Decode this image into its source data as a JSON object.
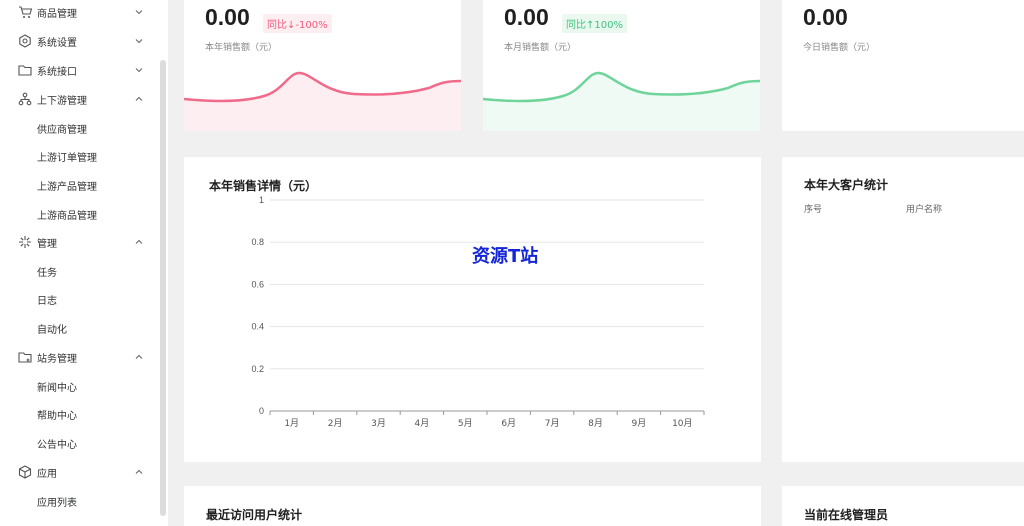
{
  "sidebar": {
    "groups": [
      {
        "label": "商品管理",
        "icon": "cart-icon",
        "expanded": false
      },
      {
        "label": "系统设置",
        "icon": "settings-icon",
        "expanded": false
      },
      {
        "label": "系统接口",
        "icon": "folder-icon",
        "expanded": false
      },
      {
        "label": "上下游管理",
        "icon": "hierarchy-icon",
        "expanded": true,
        "items": [
          "供应商管理",
          "上游订单管理",
          "上游产品管理",
          "上游商品管理"
        ]
      },
      {
        "label": "管理",
        "icon": "sparkle-icon",
        "expanded": true,
        "items": [
          "任务",
          "日志",
          "自动化"
        ]
      },
      {
        "label": "站务管理",
        "icon": "folder-add-icon",
        "expanded": true,
        "items": [
          "新闻中心",
          "帮助中心",
          "公告中心"
        ]
      },
      {
        "label": "应用",
        "icon": "cube-icon",
        "expanded": true,
        "items": [
          "应用列表"
        ]
      }
    ]
  },
  "stats": [
    {
      "value": "0.00",
      "badge": "同比↓-100%",
      "trend": "down",
      "label": "本年销售额（元）",
      "color": "#f06a8a",
      "fill": "#fdeef2"
    },
    {
      "value": "0.00",
      "badge": "同比↑100%",
      "trend": "up",
      "label": "本月销售额（元）",
      "color": "#6fd49a",
      "fill": "#eefaf3"
    },
    {
      "value": "0.00",
      "badge": "",
      "trend": "none",
      "label": "今日销售额（元）"
    }
  ],
  "sales_chart": {
    "title": "本年销售详情（元）",
    "chart_data": {
      "type": "line",
      "categories": [
        "1月",
        "2月",
        "3月",
        "4月",
        "5月",
        "6月",
        "7月",
        "8月",
        "9月",
        "10月"
      ],
      "values": [
        0,
        0,
        0,
        0,
        0,
        0,
        0,
        0,
        0,
        0
      ],
      "ylim": [
        0,
        1
      ],
      "yticks": [
        "1",
        "0.8",
        "0.6",
        "0.4",
        "0.2",
        "0"
      ],
      "title": "本年销售详情（元）",
      "xlabel": "",
      "ylabel": "",
      "grid": true
    }
  },
  "customers": {
    "title": "本年大客户统计",
    "columns": [
      "序号",
      "用户名称"
    ]
  },
  "watermark": "资源T站",
  "recent_visits": {
    "title": "最近访问用户统计"
  },
  "online_admins": {
    "title": "当前在线管理员"
  }
}
